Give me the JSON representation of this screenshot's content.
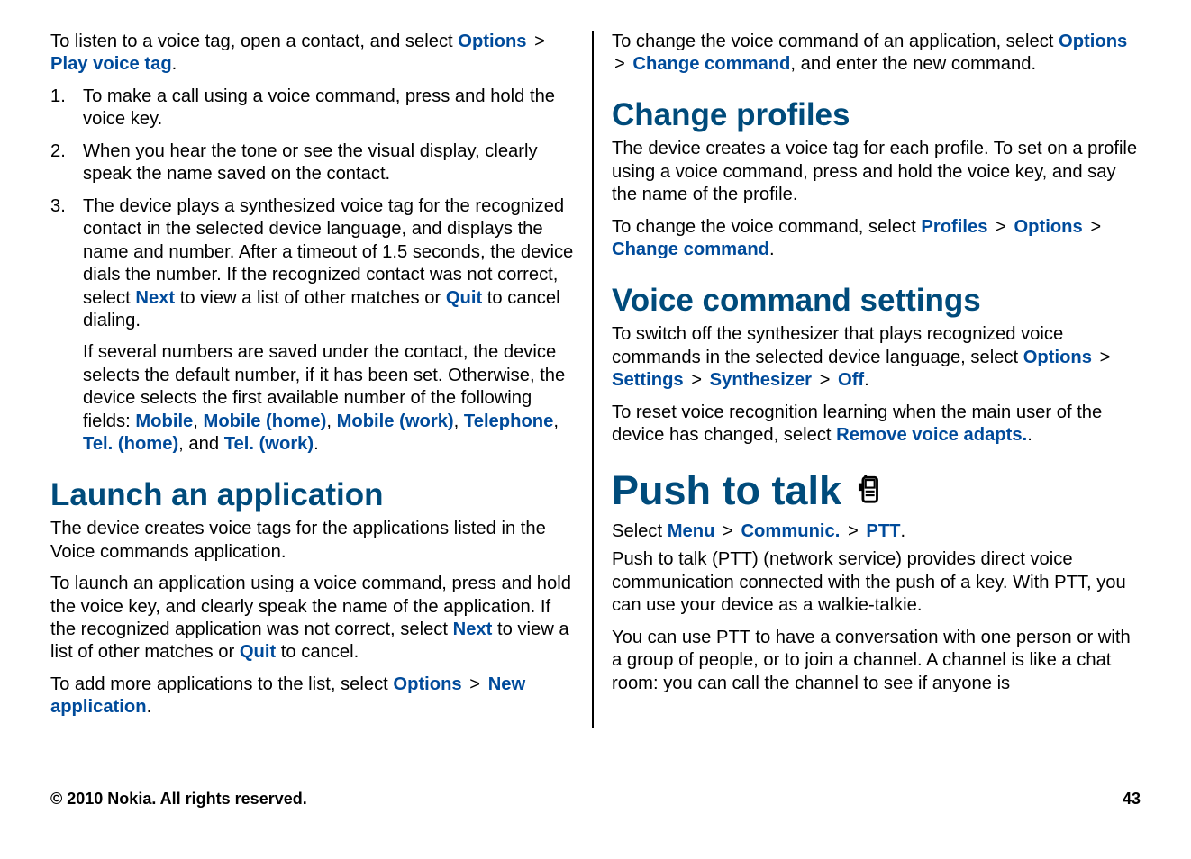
{
  "left": {
    "intro": {
      "t1": "To listen to a voice tag, open a contact, and select ",
      "options": "Options",
      "gt": ">",
      "play": "Play voice tag",
      "t_end": "."
    },
    "steps": {
      "n1": "1.",
      "s1": "To make a call using a voice command, press and hold the voice key.",
      "n2": "2.",
      "s2": "When you hear the tone or see the visual display, clearly speak the name saved on the contact.",
      "n3": "3.",
      "s3a": "The device plays a synthesized voice tag for the recognized contact in the selected device language, and displays the name and number. After a timeout of 1.5 seconds, the device dials the number. If the recognized contact was not correct, select ",
      "next": "Next",
      "s3b": " to view a list of other matches or ",
      "quit": "Quit",
      "s3c": " to cancel dialing."
    },
    "step3_cont": {
      "a": "If several numbers are saved under the contact, the device selects the default number, if it has been set. Otherwise, the device selects the first available number of the following fields: ",
      "mobile": "Mobile",
      "c1": ", ",
      "mobile_home": "Mobile (home)",
      "c2": ", ",
      "mobile_work": "Mobile (work)",
      "c3": ", ",
      "tel": "Telephone",
      "c4": ", ",
      "tel_home": "Tel. (home)",
      "and": ", and ",
      "tel_work": "Tel. (work)",
      "dot": "."
    },
    "launch_h": "Launch an application",
    "launch_p1": "The device creates voice tags for the applications listed in the Voice commands application.",
    "launch_p2a": "To launch an application using a voice command, press and hold the voice key, and clearly speak the name of the application. If the recognized application was not correct, select ",
    "launch_next": "Next",
    "launch_p2b": " to view a list of other matches or ",
    "launch_quit": "Quit",
    "launch_p2c": " to cancel.",
    "launch_p3a": "To add more applications to the list, select ",
    "launch_options": "Options",
    "launch_gt": ">",
    "launch_new_app": "New application",
    "launch_p3b": "."
  },
  "right": {
    "changecmd": {
      "a": "To change the voice command of an application, select ",
      "options": "Options",
      "gt": ">",
      "chg": "Change command",
      "b": ", and enter the new command."
    },
    "profiles_h": "Change profiles",
    "profiles_p1": "The device creates a voice tag for each profile. To set on a profile using a voice command, press and hold the voice key, and say the name of the profile.",
    "profiles_p2a": "To change the voice command, select ",
    "profiles": "Profiles",
    "gt1": ">",
    "options": "Options",
    "gt2": ">",
    "chg": "Change command",
    "profiles_p2b": ".",
    "settings_h": "Voice command settings",
    "settings_p1a": "To switch off the synthesizer that plays recognized voice commands in the selected device language, select ",
    "s_options": "Options",
    "s_gt1": ">",
    "s_settings": "Settings",
    "s_gt2": ">",
    "s_synth": "Synthesizer",
    "s_gt3": ">",
    "s_off": "Off",
    "s_dot": ".",
    "settings_p2a": "To reset voice recognition learning when the main user of the device has changed, select ",
    "s_remove": "Remove voice adapts.",
    "s_dot2": ".",
    "ptt_h": "Push to talk",
    "ptt_sel_a": "Select ",
    "ptt_menu": "Menu",
    "ptt_gt1": ">",
    "ptt_comm": "Communic.",
    "ptt_gt2": ">",
    "ptt_ptt": "PTT",
    "ptt_sel_b": ".",
    "ptt_p1": "Push to talk (PTT) (network service) provides direct voice communication connected with the push of a key. With PTT, you can use your device as a walkie-talkie.",
    "ptt_p2": "You can use PTT to have a conversation with one person or with a group of people, or to join a channel. A channel is like a chat room: you can call the channel to see if anyone is"
  },
  "footer": {
    "copyright": "© 2010 Nokia. All rights reserved.",
    "page": "43"
  }
}
